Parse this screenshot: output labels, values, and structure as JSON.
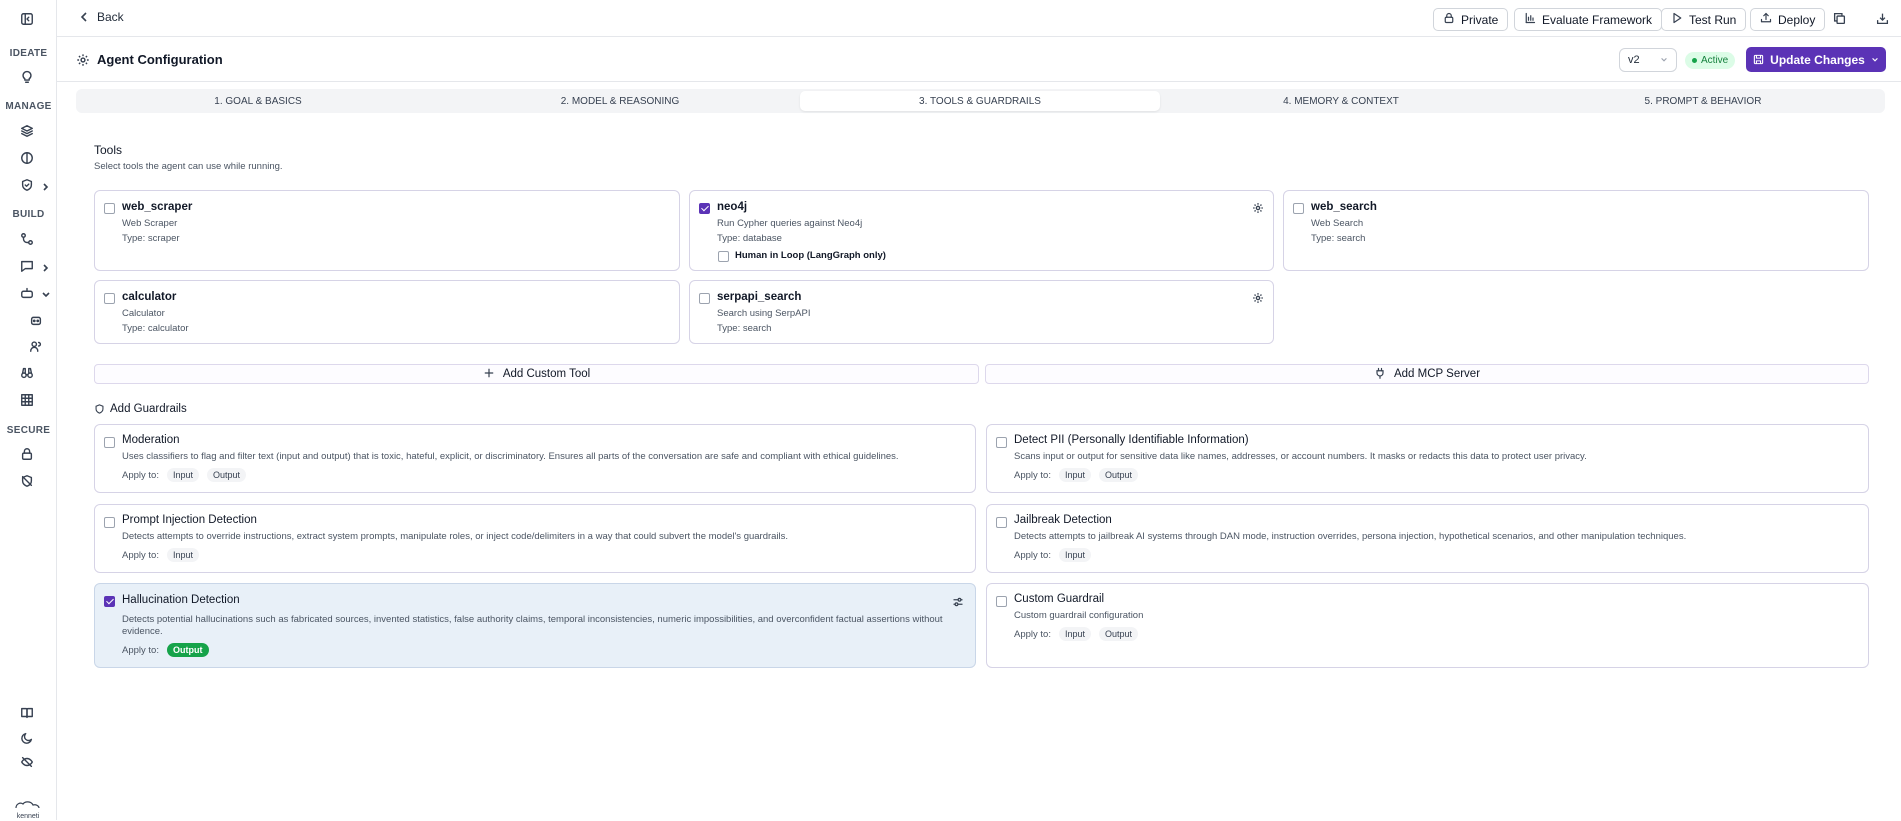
{
  "sidebar": {
    "sections": [
      "IDEATE",
      "MANAGE",
      "BUILD",
      "SECURE"
    ],
    "logo_text": "kenneti"
  },
  "topbar": {
    "back_label": "Back",
    "private_label": "Private",
    "evaluate_label": "Evaluate Framework",
    "test_run_label": "Test Run",
    "deploy_label": "Deploy"
  },
  "header": {
    "title": "Agent Configuration",
    "version": "v2",
    "status": "Active",
    "update_label": "Update Changes"
  },
  "tabs": [
    {
      "label": "1. GOAL & BASICS"
    },
    {
      "label": "2. MODEL & REASONING"
    },
    {
      "label": "3. TOOLS & GUARDRAILS",
      "active": true
    },
    {
      "label": "4. MEMORY & CONTEXT"
    },
    {
      "label": "5. PROMPT & BEHAVIOR"
    }
  ],
  "tools": {
    "title": "Tools",
    "subtitle": "Select tools the agent can use while running.",
    "items": [
      {
        "name": "web_scraper",
        "description": "Web Scraper",
        "type": "Type: scraper",
        "checked": false
      },
      {
        "name": "neo4j",
        "description": "Run Cypher queries against Neo4j",
        "type": "Type: database",
        "checked": true,
        "hitl_label": "Human in Loop (LangGraph only)"
      },
      {
        "name": "web_search",
        "description": "Web Search",
        "type": "Type: search",
        "checked": false
      },
      {
        "name": "calculator",
        "description": "Calculator",
        "type": "Type: calculator",
        "checked": false
      },
      {
        "name": "serpapi_search",
        "description": "Search using SerpAPI",
        "type": "Type: search",
        "checked": false
      }
    ],
    "add_custom_label": "Add Custom Tool",
    "add_mcp_label": "Add MCP Server"
  },
  "guardrails": {
    "title": "Add Guardrails",
    "apply_label": "Apply to:",
    "items": [
      {
        "title": "Moderation",
        "description": "Uses classifiers to flag and filter text (input and output) that is toxic, hateful, explicit, or discriminatory. Ensures all parts of the conversation are safe and compliant with ethical guidelines.",
        "apply": [
          "Input",
          "Output"
        ],
        "checked": false
      },
      {
        "title": "Detect PII (Personally Identifiable Information)",
        "description": "Scans input or output for sensitive data like names, addresses, or account numbers. It masks or redacts this data to protect user privacy.",
        "apply": [
          "Input",
          "Output"
        ],
        "checked": false
      },
      {
        "title": "Prompt Injection Detection",
        "description": "Detects attempts to override instructions, extract system prompts, manipulate roles, or inject code/delimiters in a way that could subvert the model's guardrails.",
        "apply": [
          "Input"
        ],
        "checked": false
      },
      {
        "title": "Jailbreak Detection",
        "description": "Detects attempts to jailbreak AI systems through DAN mode, instruction overrides, persona injection, hypothetical scenarios, and other manipulation techniques.",
        "apply": [
          "Input"
        ],
        "checked": false
      },
      {
        "title": "Hallucination Detection",
        "description": "Detects potential hallucinations such as fabricated sources, invented statistics, false authority claims, temporal inconsistencies, numeric impossibilities, and overconfident factual assertions without evidence.",
        "apply": [
          "Output"
        ],
        "checked": true
      },
      {
        "title": "Custom Guardrail",
        "description": "Custom guardrail configuration",
        "apply": [
          "Input",
          "Output"
        ],
        "checked": false
      }
    ]
  },
  "colors": {
    "accent": "#5b33b6",
    "active_green": "#16a34a",
    "selected_bg": "#e8f0f8"
  }
}
